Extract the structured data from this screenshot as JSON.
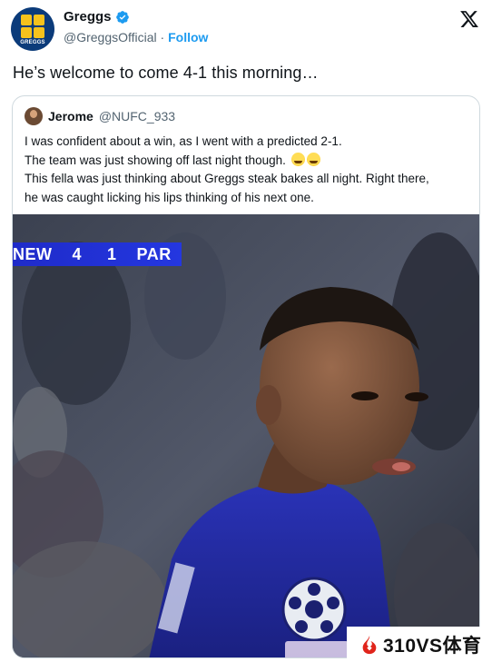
{
  "account": {
    "name": "Greggs",
    "handle": "@GreggsOfficial",
    "separator": "·",
    "follow_label": "Follow",
    "avatar_text": "GREGGS"
  },
  "tweet": {
    "text": "He’s welcome to come 4-1 this morning…"
  },
  "quoted_tweet": {
    "name": "Jerome",
    "handle": "@NUFC_933",
    "lines": [
      "I was confident about a win, as I went with a predicted 2-1.",
      "The team was just showing off last night though.",
      "This fella was just thinking about Greggs steak bakes all night. Right there,",
      "he was caught licking his lips thinking of his next one."
    ],
    "emoji": "rolling-on-floor-laughing x2"
  },
  "scoreboard": {
    "home": "NEW",
    "home_score": "4",
    "away_score": "1",
    "away": "PAR"
  },
  "watermark": {
    "text": "310VS体育"
  },
  "colors": {
    "brand_blue": "#0b3b7a",
    "brand_yellow": "#f6c21c",
    "follow_blue": "#1d9bf0",
    "scorebug_blue": "#2437e0"
  }
}
